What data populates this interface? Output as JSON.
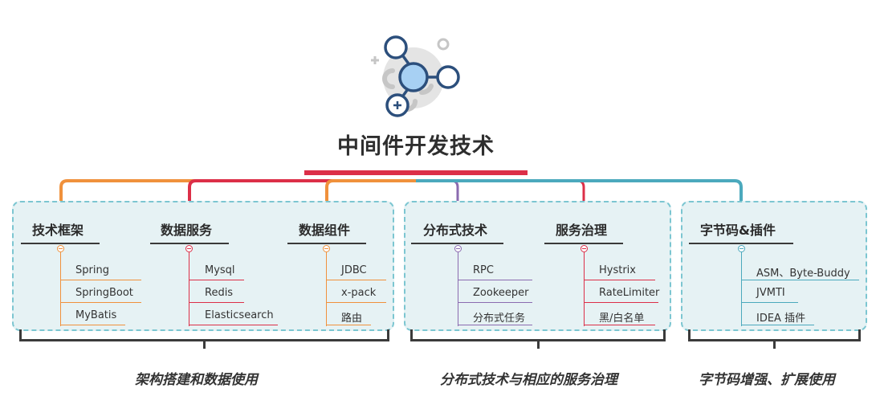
{
  "title": "中间件开发技术",
  "colors": {
    "orange": "#f0913c",
    "red": "#dc2f48",
    "teal": "#4ba9bd",
    "purple": "#8b6bb0",
    "panel_bg": "#e6f2f4",
    "panel_border": "#7cc6d1"
  },
  "icons": [
    "molecule-icon"
  ],
  "groups": [
    {
      "categories": [
        {
          "label": "技术框架",
          "items": [
            "Spring",
            "SpringBoot",
            "MyBatis"
          ]
        },
        {
          "label": "数据服务",
          "items": [
            "Mysql",
            "Redis",
            "Elasticsearch"
          ]
        },
        {
          "label": "数据组件",
          "items": [
            "JDBC",
            "x-pack",
            "路由"
          ]
        }
      ],
      "summary": "架构搭建和数据使用"
    },
    {
      "categories": [
        {
          "label": "分布式技术",
          "items": [
            "RPC",
            "Zookeeper",
            "分布式任务"
          ]
        },
        {
          "label": "服务治理",
          "items": [
            "Hystrix",
            "RateLimiter",
            "黑/白名单"
          ]
        }
      ],
      "summary": "分布式技术与相应的服务治理"
    },
    {
      "categories": [
        {
          "label": "字节码&插件",
          "items": [
            "ASM、Byte-Buddy",
            "JVMTI",
            "IDEA 插件"
          ]
        }
      ],
      "summary": "字节码增强、扩展使用"
    }
  ]
}
